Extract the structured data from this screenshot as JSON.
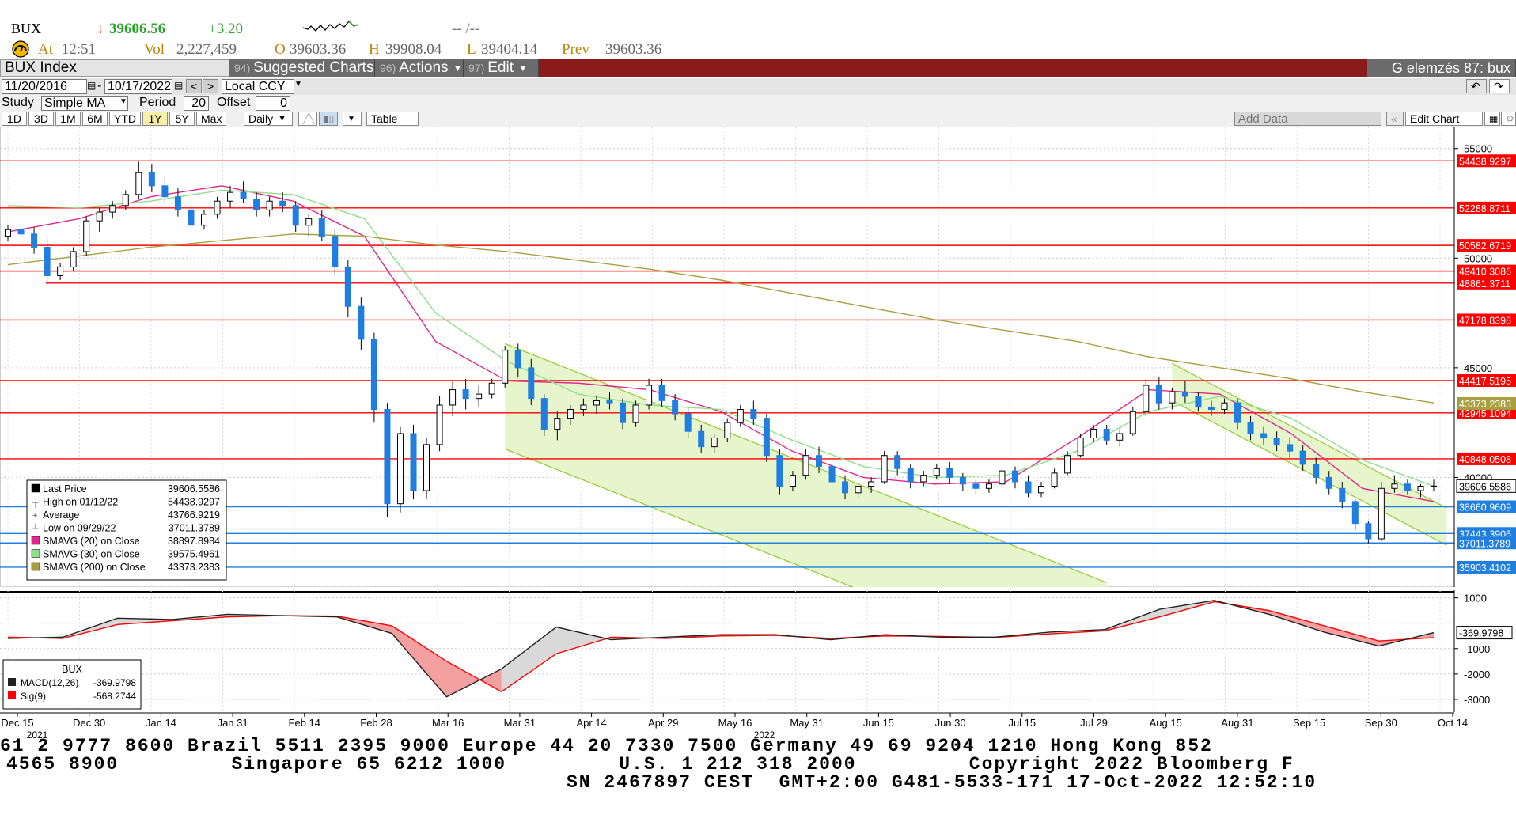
{
  "quote": {
    "ticker": "BUX",
    "arrow": "↓",
    "last": "39606.56",
    "change": "+3.20",
    "spark_dashes": "-- /--",
    "at_label": "At",
    "time": "12:51",
    "vol_label": "Vol",
    "vol": "2,227,459",
    "open_label": "O",
    "open": "39603.36",
    "high_label": "H",
    "high": "39908.04",
    "low_label": "L",
    "low": "39404.14",
    "prev_label": "Prev",
    "prev": "39603.36"
  },
  "toolbar": {
    "security": "BUX Index",
    "tabs": [
      {
        "num": "94)",
        "label": "Suggested Charts"
      },
      {
        "num": "96)",
        "label": "Actions"
      },
      {
        "num": "97)",
        "label": "Edit"
      }
    ],
    "right_title": "G elemzés 87: bux"
  },
  "range": {
    "start": "11/20/2016",
    "sep": "-",
    "end": "10/17/2022",
    "currency": "Local CCY"
  },
  "study": {
    "label": "Study",
    "type": "Simple MA",
    "period_label": "Period",
    "period": "20",
    "offset_label": "Offset",
    "offset": "0"
  },
  "periods": [
    "1D",
    "3D",
    "1M",
    "6M",
    "YTD",
    "1Y",
    "5Y",
    "Max"
  ],
  "active_period": "1Y",
  "frequency": "Daily",
  "table_label": "Table",
  "add_data_placeholder": "Add Data",
  "edit_chart_label": "Edit Chart",
  "colors": {
    "up_candle": "#ffffff",
    "down_candle": "#1f7ee0",
    "sma20": "#e0288a",
    "sma30": "#8ee08a",
    "sma200": "#a8a040",
    "hline_red": "#ff0000",
    "hline_blue": "#1f7ee0",
    "channel_fill": "#e6f5cc",
    "macd": "#222222",
    "signal": "#ff0000",
    "tabbar": "#8b1a1a"
  },
  "chart_data": [
    {
      "type": "candlestick",
      "title": "BUX",
      "ylim": [
        35000,
        56000
      ],
      "grid": true,
      "x_tick_labels": [
        "Dec 15",
        "Dec 30",
        "Jan 14",
        "Jan 31",
        "Feb 14",
        "Feb 28",
        "Mar 16",
        "Mar 31",
        "Apr 14",
        "Apr 29",
        "May 16",
        "May 31",
        "Jun 15",
        "Jun 30",
        "Jul 15",
        "Jul 29",
        "Aug 15",
        "Aug 31",
        "Sep 15",
        "Sep 30",
        "Oct 14"
      ],
      "x_year_labels": [
        "2021",
        "2022"
      ],
      "y_tick_labels": [
        "55000",
        "50000",
        "45000",
        "40000"
      ],
      "series": [
        {
          "name": "SMAVG (20)  on Close",
          "values": [
            51200,
            51800,
            52800,
            53300,
            52600,
            51000,
            46200,
            44400,
            44300,
            44000,
            43000,
            41200,
            40000,
            39700,
            39800,
            41800,
            44000,
            43800,
            42000,
            39500,
            38900
          ]
        },
        {
          "name": "SMAVG (30)  on Close",
          "values": [
            52400,
            52300,
            52600,
            53100,
            52900,
            51800,
            47500,
            45300,
            43800,
            43300,
            43100,
            41700,
            40500,
            40000,
            40100,
            41200,
            43000,
            43700,
            42700,
            40800,
            39600
          ]
        },
        {
          "name": "SMAVG (200)  on Close",
          "values": [
            49700,
            50100,
            50500,
            50800,
            51100,
            51000,
            50600,
            50300,
            49900,
            49500,
            49000,
            48400,
            47800,
            47200,
            46700,
            46200,
            45500,
            45000,
            44500,
            43900,
            43400
          ]
        }
      ],
      "candles": [
        [
          51000,
          51500,
          50800,
          51300
        ],
        [
          51300,
          51600,
          50900,
          51100
        ],
        [
          51100,
          51400,
          50200,
          50500
        ],
        [
          50500,
          50900,
          48800,
          49200
        ],
        [
          49200,
          49800,
          49000,
          49600
        ],
        [
          49600,
          50500,
          49400,
          50300
        ],
        [
          50300,
          51900,
          50100,
          51700
        ],
        [
          51700,
          52300,
          51200,
          52100
        ],
        [
          52100,
          52600,
          51800,
          52400
        ],
        [
          52400,
          53100,
          52200,
          52900
        ],
        [
          52900,
          54400,
          52700,
          53900
        ],
        [
          53900,
          54300,
          53000,
          53300
        ],
        [
          53300,
          53700,
          52500,
          52800
        ],
        [
          52800,
          53200,
          51900,
          52200
        ],
        [
          52200,
          52600,
          51100,
          51500
        ],
        [
          51500,
          52200,
          51300,
          52000
        ],
        [
          52000,
          52800,
          51800,
          52600
        ],
        [
          52600,
          53300,
          52300,
          53000
        ],
        [
          53000,
          53500,
          52500,
          52700
        ],
        [
          52700,
          53000,
          51900,
          52200
        ],
        [
          52200,
          52800,
          51900,
          52600
        ],
        [
          52600,
          53000,
          52100,
          52400
        ],
        [
          52400,
          52600,
          51200,
          51500
        ],
        [
          51500,
          52000,
          51000,
          51800
        ],
        [
          51800,
          52200,
          50800,
          51000
        ],
        [
          51000,
          51300,
          49200,
          49600
        ],
        [
          49600,
          49900,
          47300,
          47800
        ],
        [
          47800,
          48200,
          45800,
          46300
        ],
        [
          46300,
          46600,
          42500,
          43100
        ],
        [
          43100,
          43400,
          38200,
          38800
        ],
        [
          38800,
          42300,
          38400,
          42000
        ],
        [
          42000,
          42400,
          39000,
          39400
        ],
        [
          39400,
          41800,
          39000,
          41500
        ],
        [
          41500,
          43700,
          41200,
          43300
        ],
        [
          43300,
          44400,
          42800,
          44000
        ],
        [
          44000,
          44500,
          43100,
          43600
        ],
        [
          43600,
          44200,
          43200,
          43800
        ],
        [
          43800,
          44500,
          43600,
          44300
        ],
        [
          44300,
          46000,
          44100,
          45800
        ],
        [
          45800,
          46100,
          44600,
          45000
        ],
        [
          45000,
          45400,
          43300,
          43600
        ],
        [
          43600,
          43800,
          41900,
          42200
        ],
        [
          42200,
          43000,
          41700,
          42700
        ],
        [
          42700,
          43300,
          42400,
          43100
        ],
        [
          43100,
          43600,
          42800,
          43300
        ],
        [
          43300,
          43700,
          42900,
          43500
        ],
        [
          43500,
          43900,
          43100,
          43400
        ],
        [
          43400,
          43600,
          42200,
          42500
        ],
        [
          42500,
          43500,
          42300,
          43300
        ],
        [
          43300,
          44500,
          43100,
          44200
        ],
        [
          44200,
          44500,
          43200,
          43500
        ],
        [
          43500,
          43800,
          42600,
          42900
        ],
        [
          42900,
          43200,
          41800,
          42100
        ],
        [
          42100,
          42400,
          41100,
          41400
        ],
        [
          41400,
          42000,
          41100,
          41800
        ],
        [
          41800,
          42700,
          41600,
          42500
        ],
        [
          42500,
          43300,
          42300,
          43100
        ],
        [
          43100,
          43500,
          42400,
          42700
        ],
        [
          42700,
          42900,
          40700,
          41000
        ],
        [
          41000,
          41300,
          39200,
          39600
        ],
        [
          39600,
          40300,
          39400,
          40100
        ],
        [
          40100,
          41300,
          39900,
          41000
        ],
        [
          41000,
          41400,
          40200,
          40500
        ],
        [
          40500,
          40800,
          39500,
          39800
        ],
        [
          39800,
          40100,
          39000,
          39300
        ],
        [
          39300,
          39800,
          39100,
          39600
        ],
        [
          39600,
          40000,
          39300,
          39800
        ],
        [
          39800,
          41200,
          39700,
          41000
        ],
        [
          41000,
          41200,
          40100,
          40400
        ],
        [
          40400,
          40600,
          39500,
          39800
        ],
        [
          39800,
          40300,
          39600,
          40100
        ],
        [
          40100,
          40600,
          39900,
          40400
        ],
        [
          40400,
          40700,
          39700,
          40000
        ],
        [
          40000,
          40200,
          39400,
          39700
        ],
        [
          39700,
          39900,
          39200,
          39500
        ],
        [
          39500,
          39900,
          39300,
          39700
        ],
        [
          39700,
          40500,
          39600,
          40300
        ],
        [
          40300,
          40500,
          39500,
          39800
        ],
        [
          39800,
          40100,
          39100,
          39300
        ],
        [
          39300,
          39800,
          39100,
          39600
        ],
        [
          39600,
          40400,
          39500,
          40200
        ],
        [
          40200,
          41200,
          40100,
          41000
        ],
        [
          41000,
          42000,
          40900,
          41800
        ],
        [
          41800,
          42400,
          41600,
          42200
        ],
        [
          42200,
          42400,
          41500,
          41700
        ],
        [
          41700,
          42200,
          41400,
          42000
        ],
        [
          42000,
          43200,
          41900,
          43000
        ],
        [
          43000,
          44500,
          42800,
          44200
        ],
        [
          44200,
          44600,
          43100,
          43400
        ],
        [
          43400,
          44100,
          43100,
          43900
        ],
        [
          43900,
          44400,
          43400,
          43700
        ],
        [
          43700,
          43900,
          43000,
          43200
        ],
        [
          43200,
          43500,
          42800,
          43100
        ],
        [
          43100,
          43600,
          42900,
          43400
        ],
        [
          43400,
          43600,
          42200,
          42500
        ],
        [
          42500,
          42800,
          41700,
          42000
        ],
        [
          42000,
          42300,
          41500,
          41800
        ],
        [
          41800,
          42100,
          41200,
          41500
        ],
        [
          41500,
          41800,
          40900,
          41200
        ],
        [
          41200,
          41500,
          40300,
          40600
        ],
        [
          40600,
          40900,
          39700,
          40000
        ],
        [
          40000,
          40300,
          39200,
          39500
        ],
        [
          39500,
          39800,
          38600,
          38900
        ],
        [
          38900,
          39000,
          37600,
          37900
        ],
        [
          37900,
          38000,
          37000,
          37200
        ],
        [
          37200,
          39800,
          37100,
          39500
        ],
        [
          39500,
          40100,
          39300,
          39700
        ],
        [
          39700,
          39900,
          39200,
          39400
        ],
        [
          39400,
          39700,
          39100,
          39600
        ],
        [
          39600,
          39900,
          39400,
          39606.56
        ]
      ],
      "hlines": [
        {
          "label": "54438.9297",
          "value": 54438.9297,
          "color": "red"
        },
        {
          "label": "52288.8711",
          "value": 52288.8711,
          "color": "red"
        },
        {
          "label": "50582.6719",
          "value": 50582.6719,
          "color": "red"
        },
        {
          "label": "49410.3086",
          "value": 49410.3086,
          "color": "red"
        },
        {
          "label": "48861.3711",
          "value": 48861.3711,
          "color": "red"
        },
        {
          "label": "47178.8398",
          "value": 47178.8398,
          "color": "red"
        },
        {
          "label": "44417.5195",
          "value": 44417.5195,
          "color": "red"
        },
        {
          "label": "42945.1094",
          "value": 42945.1094,
          "color": "red"
        },
        {
          "label": "40848.0508",
          "value": 40848.0508,
          "color": "red"
        },
        {
          "label": "38660.9609",
          "value": 38660.9609,
          "color": "blue"
        },
        {
          "label": "37443.3906",
          "value": 37443.3906,
          "color": "blue"
        },
        {
          "label": "37011.3789",
          "value": 37011.3789,
          "color": "blue"
        },
        {
          "label": "35903.4102",
          "value": 35903.4102,
          "color": "blue"
        }
      ],
      "last_price_label": "39606.5586",
      "sma200_label": "43373.2383",
      "legend": {
        "rows": [
          {
            "label": "Last Price",
            "value": "39606.5586"
          },
          {
            "label": "High on 01/12/22",
            "value": "54438.9297"
          },
          {
            "label": "Average",
            "value": "43766.9219"
          },
          {
            "label": "Low on 09/29/22",
            "value": "37011.3789"
          },
          {
            "label": "SMAVG (20)  on Close",
            "value": "38897.8984"
          },
          {
            "label": "SMAVG (30)  on Close",
            "value": "39575.4961"
          },
          {
            "label": "SMAVG (200)  on Close",
            "value": "43373.2383"
          }
        ]
      }
    },
    {
      "type": "line",
      "title": "BUX",
      "ylim": [
        -3500,
        1300
      ],
      "y_tick_labels": [
        "1000",
        "-1000",
        "-2000",
        "-3000"
      ],
      "series": [
        {
          "name": "MACD(12,26)",
          "values": [
            -600,
            -550,
            200,
            150,
            350,
            300,
            250,
            -400,
            -2900,
            -1800,
            -150,
            -650,
            -550,
            -450,
            -450,
            -650,
            -450,
            -550,
            -550,
            -350,
            -250,
            550,
            900,
            350,
            -350,
            -900,
            -370
          ]
        },
        {
          "name": "Sig(9)",
          "values": [
            -550,
            -600,
            -50,
            100,
            250,
            300,
            280,
            -100,
            -1500,
            -2700,
            -1200,
            -550,
            -600,
            -500,
            -480,
            -600,
            -500,
            -520,
            -560,
            -420,
            -300,
            250,
            850,
            500,
            -100,
            -700,
            -568
          ]
        }
      ],
      "legend": {
        "title": "BUX",
        "rows": [
          {
            "label": "MACD(12,26)",
            "value": "-369.9798"
          },
          {
            "label": "Sig(9)",
            "value": "-568.2744"
          }
        ]
      },
      "last_label": "-369.9798"
    }
  ],
  "footer": {
    "line1": "61 2 9777 8600 Brazil 5511 2395 9000 Europe 44 20 7330 7500 Germany 49 69 9204 1210 Hong Kong 852",
    "line2": "4565 8900         Singapore 65 6212 1000         U.S. 1 212 318 2000         Copyright 2022 Bloomberg F",
    "line3": "SN 2467897 CEST  GMT+2:00 G481-5533-171 17-Oct-2022 12:52:10"
  }
}
